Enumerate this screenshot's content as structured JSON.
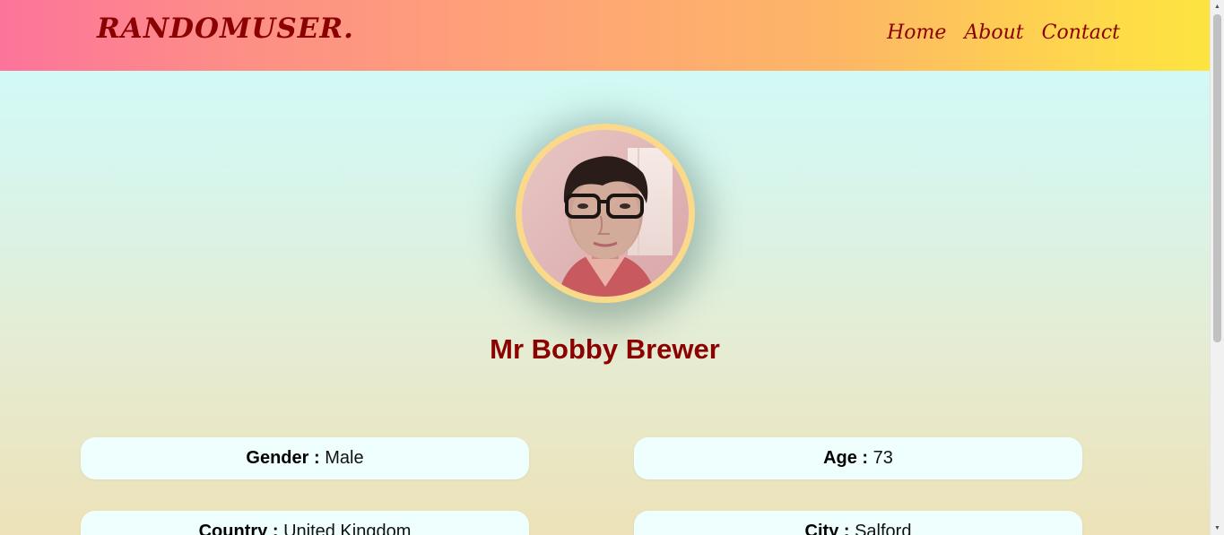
{
  "nav": {
    "brand": "RANDOMUSER.",
    "links": [
      "Home",
      "About",
      "Contact"
    ]
  },
  "profile": {
    "name": "Mr Bobby Brewer",
    "avatar_icon": "user-photo"
  },
  "details": {
    "gender_label": "Gender :",
    "gender_value": "Male",
    "age_label": "Age :",
    "age_value": "73",
    "country_label": "Country :",
    "country_value": "United Kingdom",
    "city_label": "City :",
    "city_value": "Salford"
  },
  "colors": {
    "brand_text": "#8b0000",
    "name_text": "#8b0000",
    "card_bg": "#effffe",
    "avatar_ring": "#fbd98b"
  }
}
